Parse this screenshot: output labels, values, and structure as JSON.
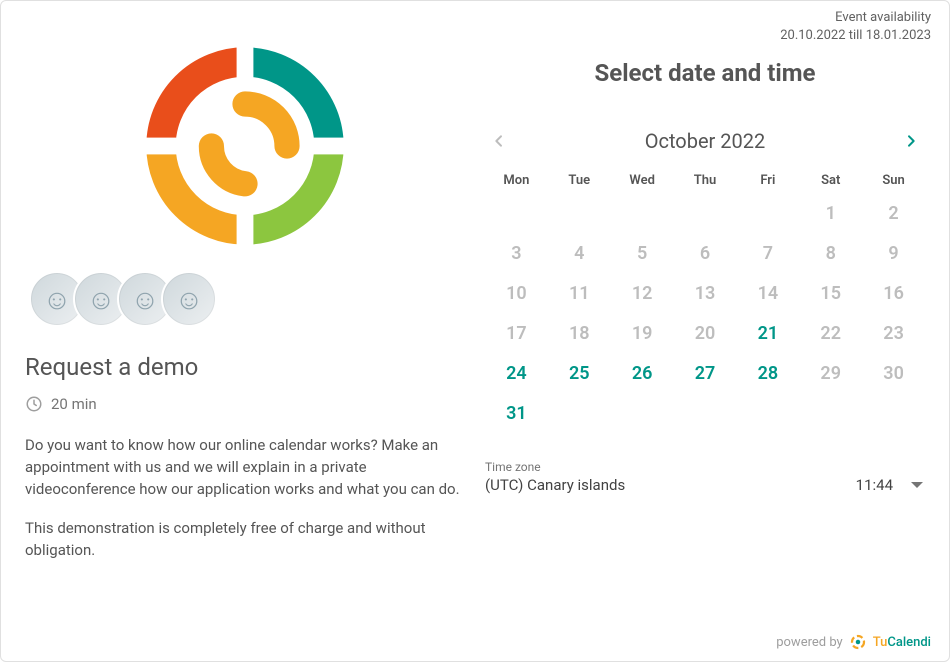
{
  "availability": {
    "label": "Event availability",
    "range": "20.10.2022 till 18.01.2023"
  },
  "event": {
    "title": "Request a demo",
    "duration": "20 min",
    "description_1": "Do you want to know how our online calendar works? Make an appointment with us and we will explain in a private videoconference how our application works and what you can do.",
    "description_2": "This demonstration is completely free of charge and without obligation."
  },
  "picker": {
    "title": "Select date and time",
    "month_label": "October 2022",
    "dow": [
      "Mon",
      "Tue",
      "Wed",
      "Thu",
      "Fri",
      "Sat",
      "Sun"
    ]
  },
  "calendar": {
    "leading_blanks": 5,
    "days": [
      {
        "n": "1",
        "available": false
      },
      {
        "n": "2",
        "available": false
      },
      {
        "n": "3",
        "available": false
      },
      {
        "n": "4",
        "available": false
      },
      {
        "n": "5",
        "available": false
      },
      {
        "n": "6",
        "available": false
      },
      {
        "n": "7",
        "available": false
      },
      {
        "n": "8",
        "available": false
      },
      {
        "n": "9",
        "available": false
      },
      {
        "n": "10",
        "available": false
      },
      {
        "n": "11",
        "available": false
      },
      {
        "n": "12",
        "available": false
      },
      {
        "n": "13",
        "available": false
      },
      {
        "n": "14",
        "available": false
      },
      {
        "n": "15",
        "available": false
      },
      {
        "n": "16",
        "available": false
      },
      {
        "n": "17",
        "available": false
      },
      {
        "n": "18",
        "available": false
      },
      {
        "n": "19",
        "available": false
      },
      {
        "n": "20",
        "available": false
      },
      {
        "n": "21",
        "available": true
      },
      {
        "n": "22",
        "available": false
      },
      {
        "n": "23",
        "available": false
      },
      {
        "n": "24",
        "available": true
      },
      {
        "n": "25",
        "available": true
      },
      {
        "n": "26",
        "available": true
      },
      {
        "n": "27",
        "available": true
      },
      {
        "n": "28",
        "available": true
      },
      {
        "n": "29",
        "available": false
      },
      {
        "n": "30",
        "available": false
      },
      {
        "n": "31",
        "available": true
      }
    ]
  },
  "timezone": {
    "label": "Time zone",
    "value": "(UTC) Canary islands",
    "time": "11:44"
  },
  "footer": {
    "powered": "powered by",
    "brand_tu": "Tu",
    "brand_cal": "Calendi"
  },
  "colors": {
    "accent": "#009688",
    "orange": "#f5a623",
    "red": "#e94e1b",
    "green": "#8cc63f",
    "muted": "#bdbdbd"
  }
}
